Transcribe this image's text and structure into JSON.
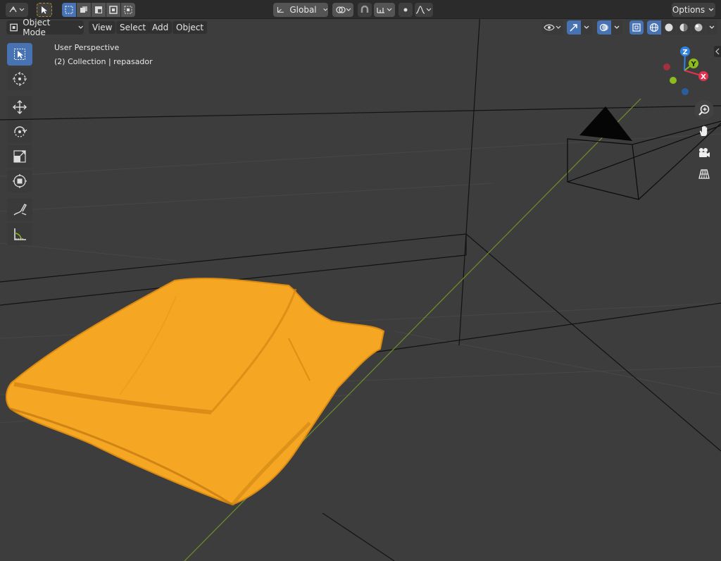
{
  "topbar": {
    "orientation_label": "Global",
    "options_label": "Options"
  },
  "header": {
    "mode_label": "Object Mode",
    "menu": [
      "View",
      "Select",
      "Add",
      "Object"
    ]
  },
  "viewport": {
    "perspective_label": "User Perspective",
    "collection_label": "(2) Collection | repasador"
  },
  "gizmo": {
    "axes": {
      "x": "X",
      "y": "Y",
      "z": "Z"
    },
    "colors": {
      "x": "#e2344f",
      "y": "#8bbd1d",
      "z": "#2f84e3",
      "selection": "#f5a623"
    }
  },
  "theme": {
    "accent": "#4772b3",
    "viewport_bg": "#3d3d3d",
    "object_orange": "#f5a623"
  }
}
